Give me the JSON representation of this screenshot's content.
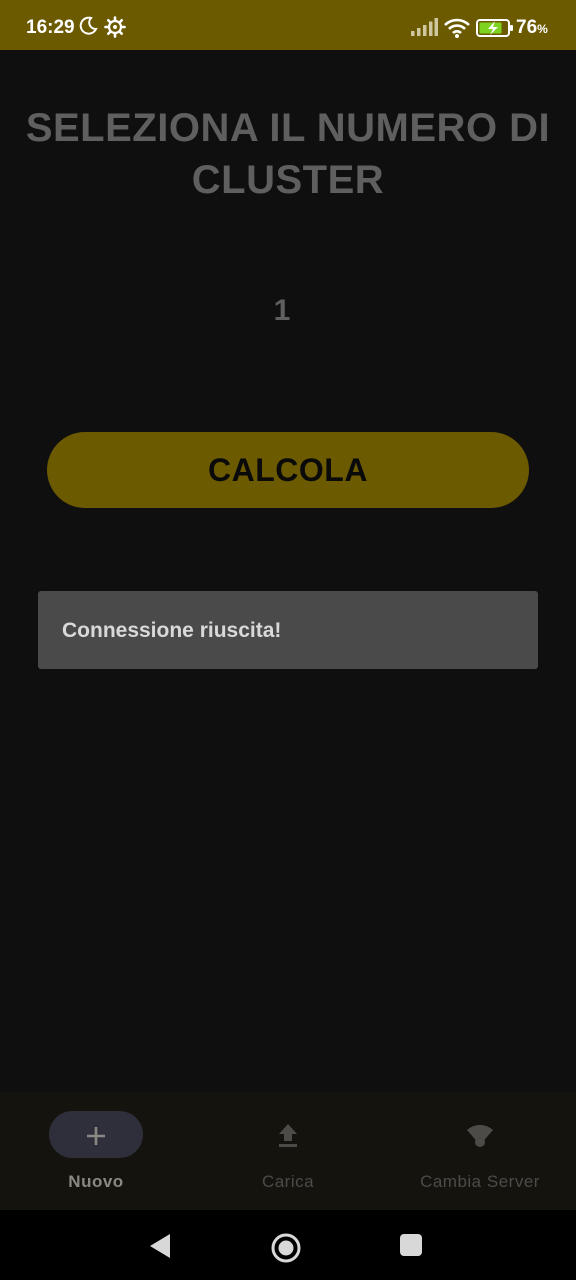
{
  "status_bar": {
    "time": "16:29",
    "battery_percent": "76",
    "battery_unit": "%",
    "icons": [
      "moon-icon",
      "gear-icon",
      "signal-icon",
      "wifi-icon",
      "battery-charging-icon"
    ]
  },
  "main": {
    "title_line1": "SELEZIONA IL NUMERO DI",
    "title_line2": "CLUSTER",
    "cluster_value": "1",
    "calc_button_label": "CALCOLA",
    "toast_message": "Connessione riuscita!"
  },
  "bottom_nav": {
    "items": [
      {
        "label": "Nuovo",
        "icon": "plus-icon",
        "selected": true
      },
      {
        "label": "Carica",
        "icon": "upload-icon",
        "selected": false
      },
      {
        "label": "Cambia Server",
        "icon": "wifi-server-icon",
        "selected": false
      }
    ]
  },
  "colors": {
    "accent": "#6b5a00",
    "background": "#0f0f0f",
    "title_text": "#5f5f5f",
    "toast_bg": "#4a4a4a"
  }
}
